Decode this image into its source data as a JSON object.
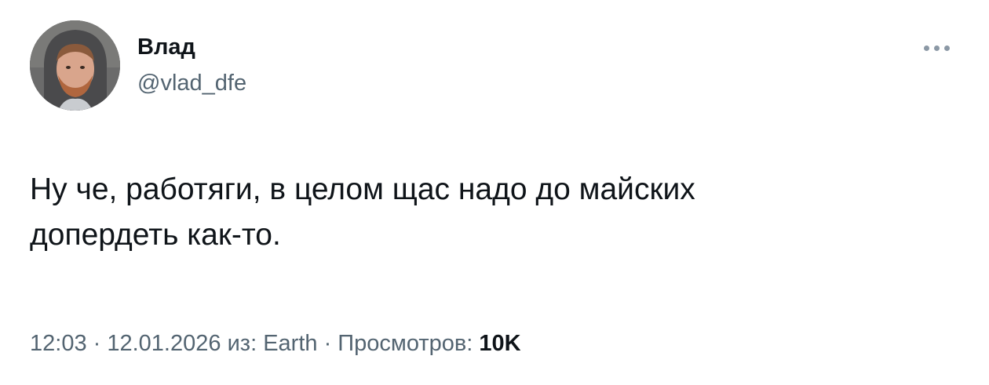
{
  "author": {
    "display_name": "Влад",
    "handle": "@vlad_dfe"
  },
  "tweet": {
    "text": "Ну че, работяги, в целом щас надо до майских\nдопердеть как-то."
  },
  "meta": {
    "time": "12:03",
    "separator_1": " · ",
    "date": "12.01.2026",
    "source_prefix": " из: ",
    "source": "Earth",
    "separator_2": " · ",
    "views_label": "Просмотров: ",
    "views_count": "10K"
  },
  "icons": {
    "more": "more-horizontal-icon"
  },
  "colors": {
    "text_primary": "#0f1419",
    "text_secondary": "#536471",
    "more_dots": "#8b98a5",
    "background": "#ffffff"
  }
}
